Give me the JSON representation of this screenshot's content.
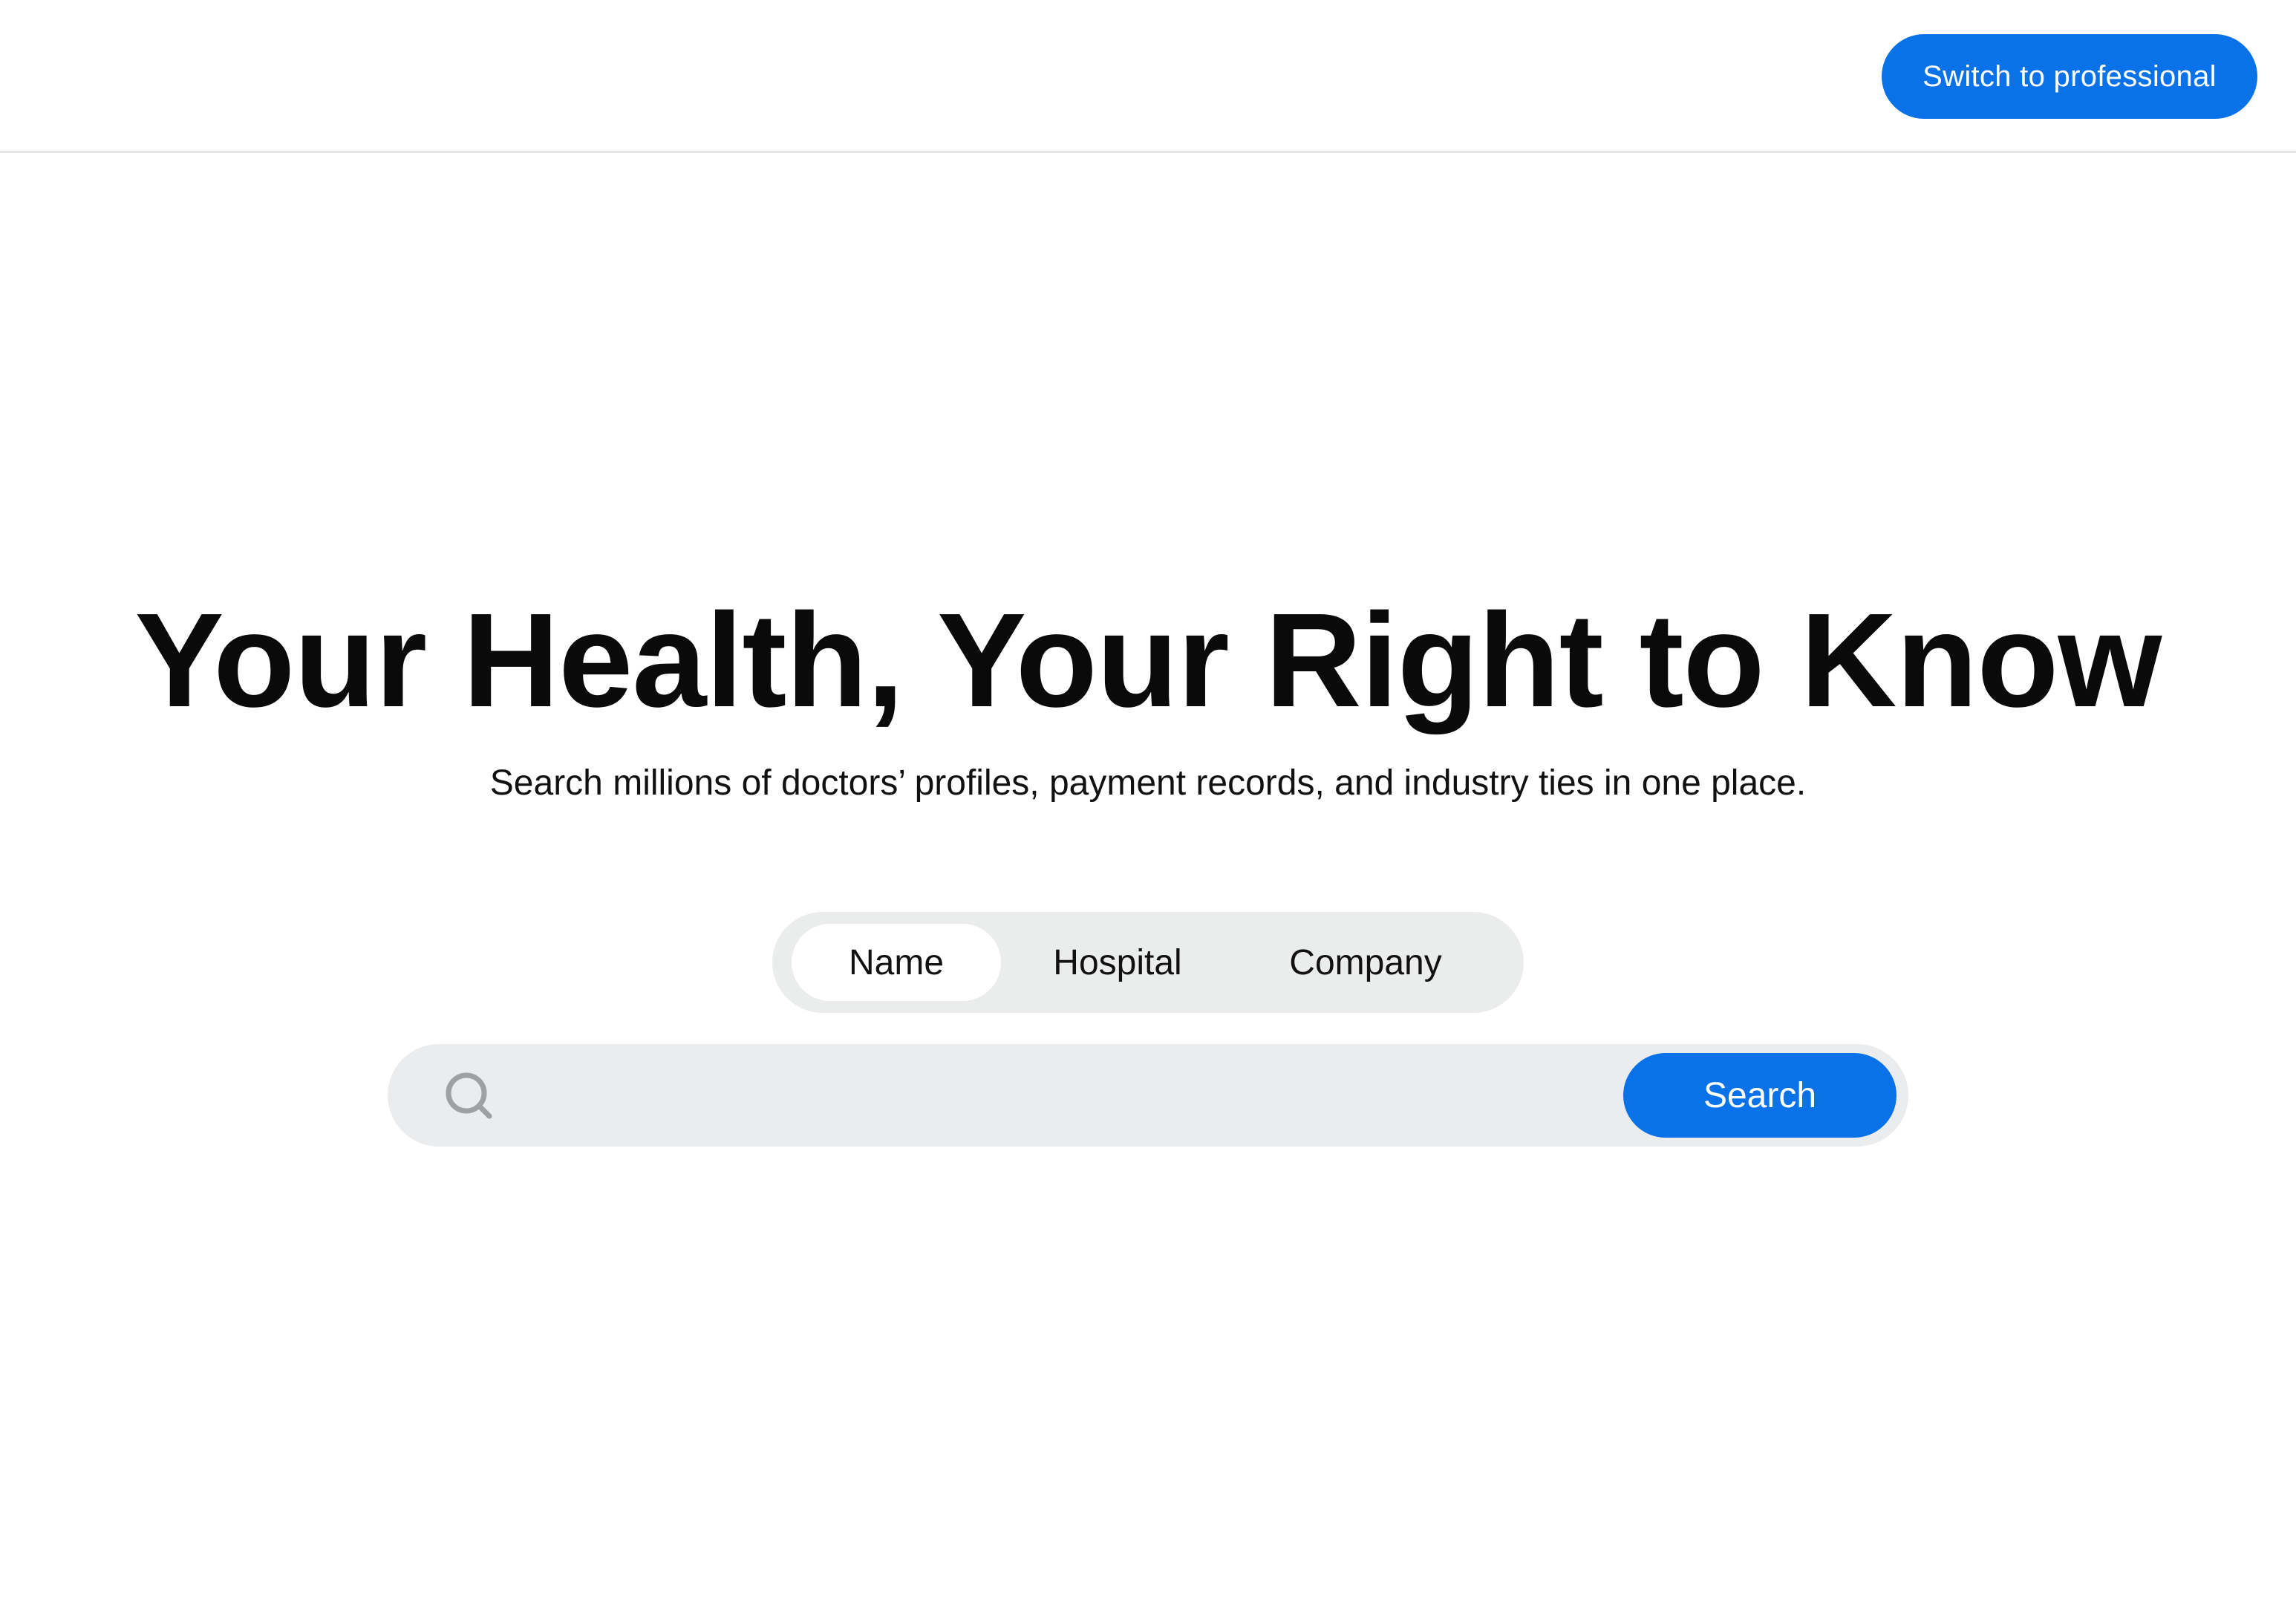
{
  "header": {
    "switch_button_label": "Switch to professional"
  },
  "hero": {
    "title": "Your Health, Your Right to Know",
    "subtitle": "Search millions of doctors’ profiles, payment records, and industry ties in one place."
  },
  "search_tabs": {
    "items": [
      {
        "label": "Name",
        "active": true
      },
      {
        "label": "Hospital",
        "active": false
      },
      {
        "label": "Company",
        "active": false
      }
    ]
  },
  "search": {
    "input_value": "",
    "placeholder": "",
    "button_label": "Search",
    "icon": "search-icon"
  },
  "colors": {
    "accent": "#0a72e8",
    "tab_track": "#ebecec",
    "search_track": "#ebeced",
    "icon_gray": "#9ea1a3"
  }
}
